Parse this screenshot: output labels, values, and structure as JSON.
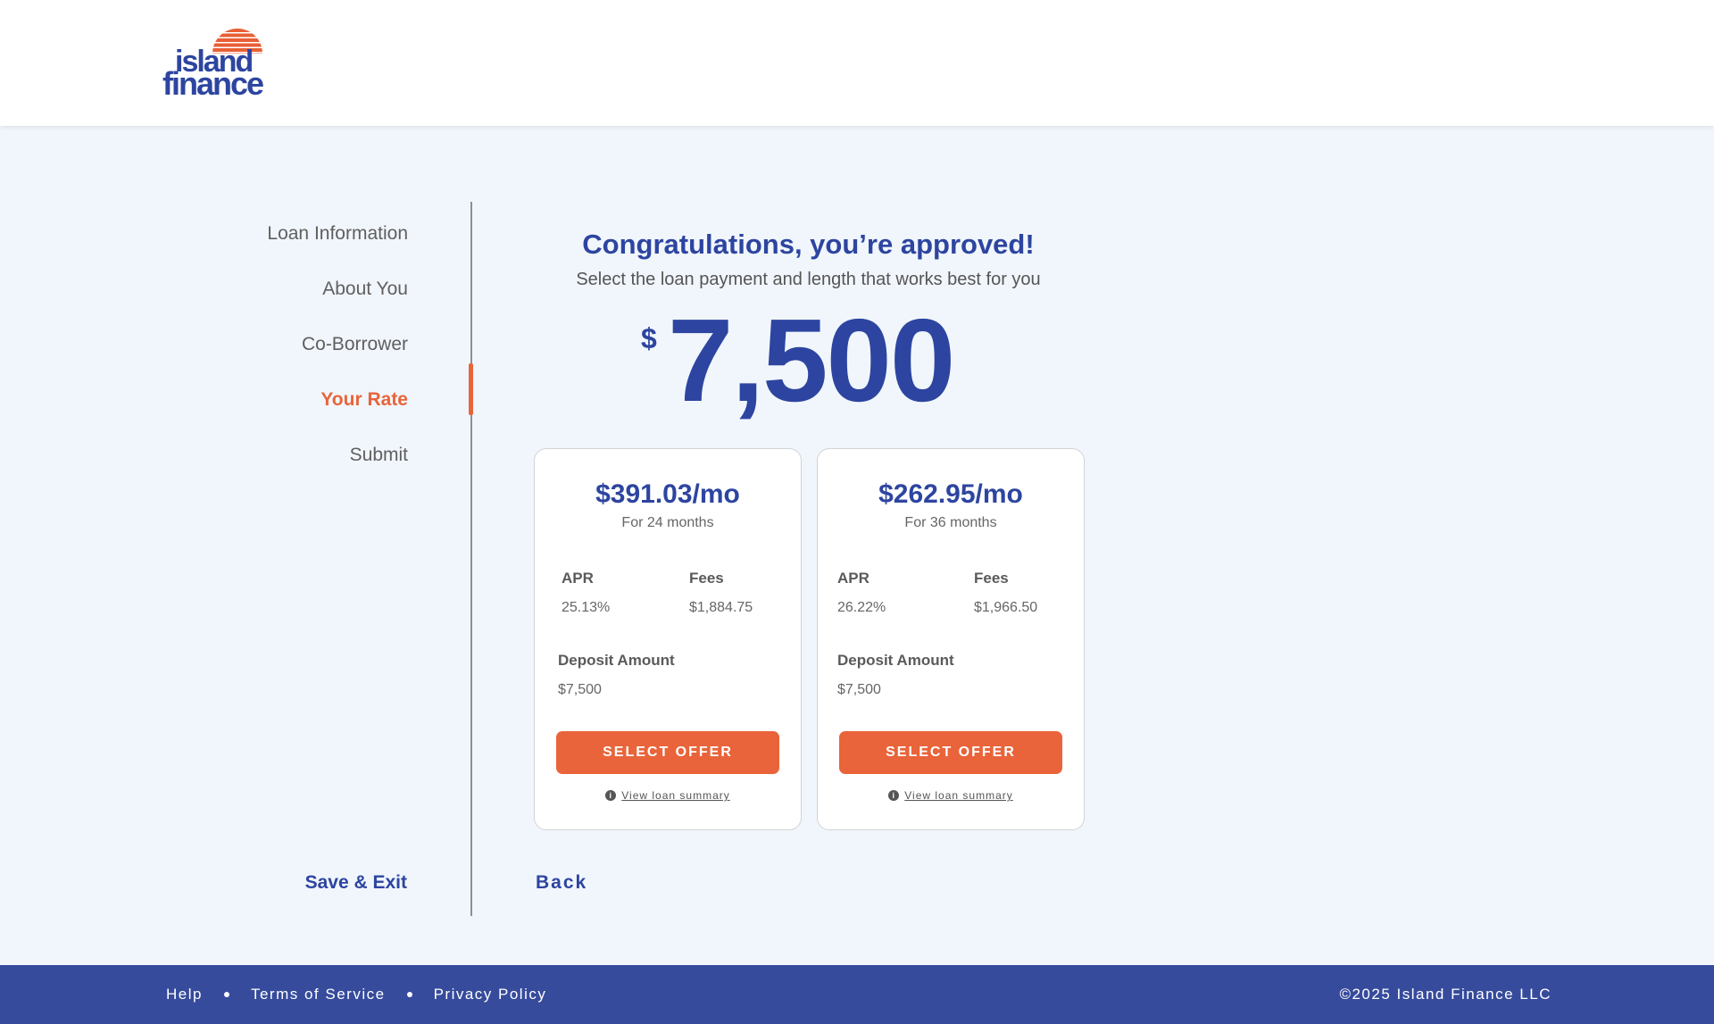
{
  "header": {
    "logo_word_top": "island",
    "logo_word_bottom": "finance",
    "logo_color": "#2d45a0",
    "logo_sun_color": "#e85f35"
  },
  "steps": [
    {
      "label": "Loan Information",
      "active": false
    },
    {
      "label": "About You",
      "active": false
    },
    {
      "label": "Co-Borrower",
      "active": false
    },
    {
      "label": "Your Rate",
      "active": true
    },
    {
      "label": "Submit",
      "active": false
    }
  ],
  "save_exit_label": "Save & Exit",
  "back_label": "Back",
  "main": {
    "title": "Congratulations, you’re approved!",
    "subtitle": "Select the loan payment and length that works best for you",
    "amount_symbol": "$",
    "amount_value": "7,500"
  },
  "offers": [
    {
      "monthly": "$391.03/mo",
      "term": "For 24 months",
      "apr_label": "APR",
      "apr": "25.13%",
      "fees_label": "Fees",
      "fees": "$1,884.75",
      "deposit_label": "Deposit Amount",
      "deposit": "$7,500",
      "button_label": "SELECT OFFER",
      "summary_link": "View loan summary"
    },
    {
      "monthly": "$262.95/mo",
      "term": "For 36 months",
      "apr_label": "APR",
      "apr": "26.22%",
      "fees_label": "Fees",
      "fees": "$1,966.50",
      "deposit_label": "Deposit Amount",
      "deposit": "$7,500",
      "button_label": "SELECT OFFER",
      "summary_link": "View loan summary"
    }
  ],
  "footer": {
    "links": [
      "Help",
      "Terms of Service",
      "Privacy Policy"
    ],
    "copyright": "©2025 Island Finance LLC"
  },
  "colors": {
    "brand_blue": "#2d45a0",
    "accent_orange": "#e9643a",
    "footer_bg": "#364b9c",
    "page_bg": "#f1f6fc"
  }
}
